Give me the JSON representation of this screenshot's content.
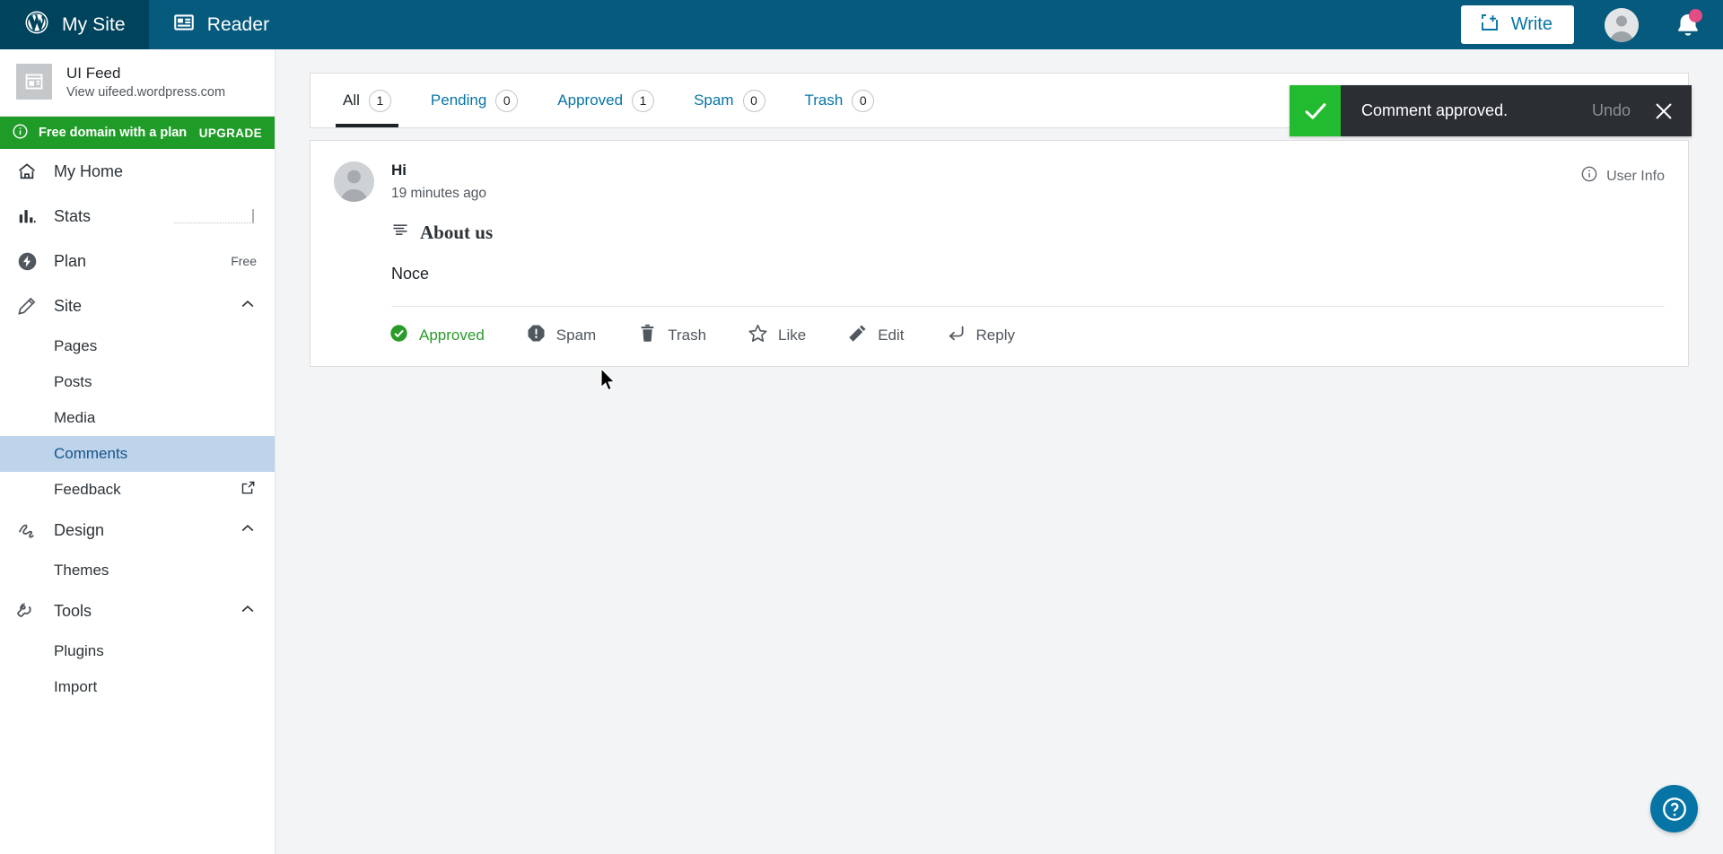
{
  "masthead": {
    "my_site_label": "My Site",
    "reader_label": "Reader",
    "write_label": "Write"
  },
  "sidebar": {
    "site": {
      "name": "UI Feed",
      "url": "View uifeed.wordpress.com"
    },
    "upgrade_banner": {
      "text": "Free domain with a plan",
      "cta": "UPGRADE",
      "bg_color": "#1f9c28"
    },
    "nav": [
      {
        "label": "My Home",
        "icon": "home-icon",
        "right": ""
      },
      {
        "label": "Stats",
        "icon": "stats-icon",
        "right": ""
      },
      {
        "label": "Plan",
        "icon": "plan-icon",
        "right": "Free"
      },
      {
        "label": "Site",
        "icon": "pencil-icon",
        "right": ""
      }
    ],
    "site_children": [
      {
        "label": "Pages"
      },
      {
        "label": "Posts"
      },
      {
        "label": "Media"
      },
      {
        "label": "Comments"
      },
      {
        "label": "Feedback"
      }
    ],
    "design": {
      "label": "Design",
      "icon": "brush-icon"
    },
    "design_children": [
      {
        "label": "Themes"
      }
    ],
    "tools": {
      "label": "Tools",
      "icon": "wrench-icon"
    },
    "tools_children": [
      {
        "label": "Plugins"
      },
      {
        "label": "Import"
      }
    ],
    "active_item": "Comments",
    "active_bg": "#bdd4ea",
    "active_color": "#17548a"
  },
  "tabs": [
    {
      "label": "All",
      "count": "1",
      "active": true
    },
    {
      "label": "Pending",
      "count": "0",
      "active": false
    },
    {
      "label": "Approved",
      "count": "1",
      "active": false
    },
    {
      "label": "Spam",
      "count": "0",
      "active": false
    },
    {
      "label": "Trash",
      "count": "0",
      "active": false
    }
  ],
  "comment": {
    "author": "Hi",
    "time": "19 minutes ago",
    "user_info_label": "User Info",
    "post_title": "About us",
    "body": "Noce",
    "actions": [
      {
        "label": "Approved",
        "icon": "check-circle-icon",
        "state": "approved"
      },
      {
        "label": "Spam",
        "icon": "spam-icon",
        "state": "normal"
      },
      {
        "label": "Trash",
        "icon": "trash-icon",
        "state": "normal"
      },
      {
        "label": "Like",
        "icon": "star-icon",
        "state": "normal"
      },
      {
        "label": "Edit",
        "icon": "pencil-icon",
        "state": "normal"
      },
      {
        "label": "Reply",
        "icon": "reply-icon",
        "state": "normal"
      }
    ]
  },
  "toast": {
    "message": "Comment approved.",
    "undo_label": "Undo",
    "icon": "checkmark-icon",
    "accent_color": "#22ba2f",
    "bg_color": "#2b2f33"
  }
}
